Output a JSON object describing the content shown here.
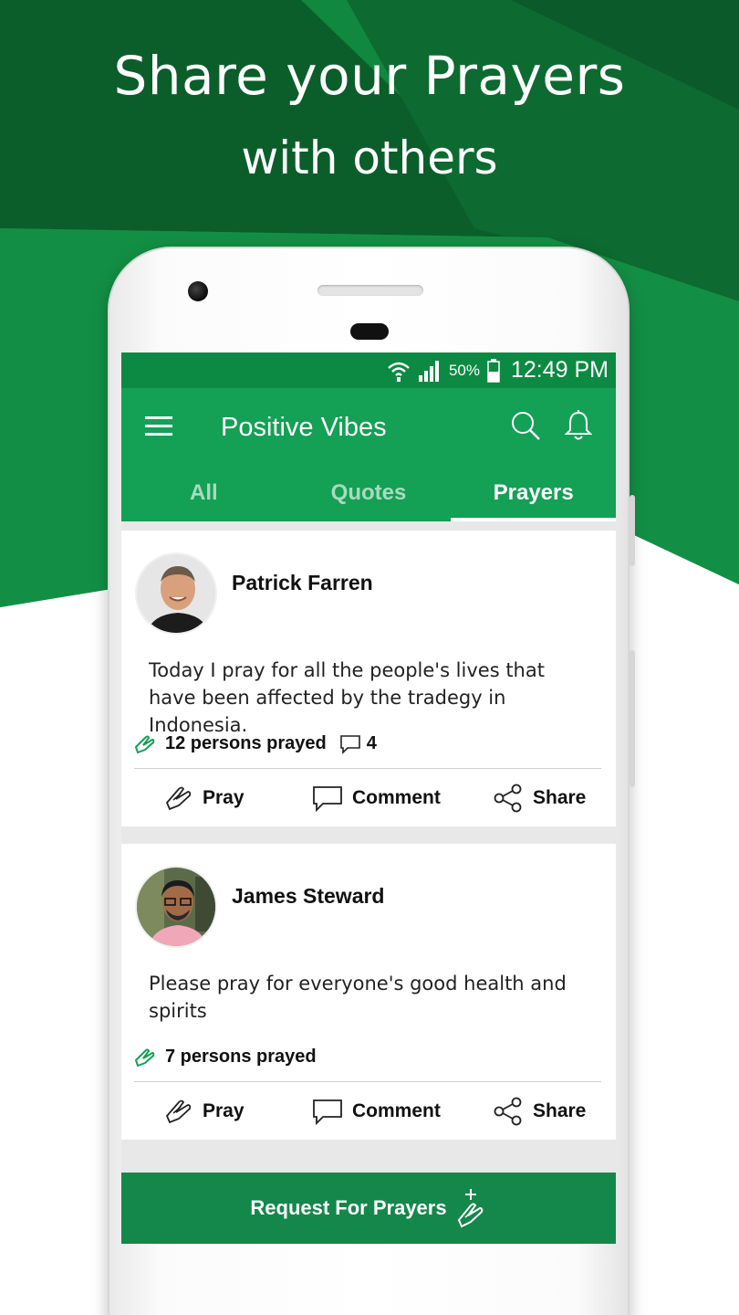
{
  "promo": {
    "headline_line1": "Share your Prayers",
    "headline_line2": "with others"
  },
  "colors": {
    "bg_dark_green": "#0b5e2a",
    "bg_green": "#129245",
    "app_green": "#14a055",
    "status_green": "#0c8a43",
    "button_green": "#13884a"
  },
  "statusbar": {
    "battery": "50%",
    "time": "12:49 PM",
    "icons": [
      "wifi-icon",
      "signal-icon",
      "battery-icon"
    ]
  },
  "appbar": {
    "title": "Positive Vibes",
    "icons": [
      "menu-icon",
      "search-icon",
      "bell-icon"
    ]
  },
  "tabs": [
    {
      "label": "All",
      "active": false
    },
    {
      "label": "Quotes",
      "active": false
    },
    {
      "label": "Prayers",
      "active": true
    }
  ],
  "posts": [
    {
      "name": "Patrick Farren",
      "text": "Today I pray for all the people's lives that have been affected by the tradegy in Indonesia.",
      "prayed": "12 persons prayed",
      "comments": "4"
    },
    {
      "name": "James Steward",
      "text": "Please pray for everyone's good health and spirits",
      "prayed": "7 persons prayed"
    }
  ],
  "actions": {
    "pray": "Pray",
    "comment": "Comment",
    "share": "Share"
  },
  "request_button": "Request For Prayers"
}
